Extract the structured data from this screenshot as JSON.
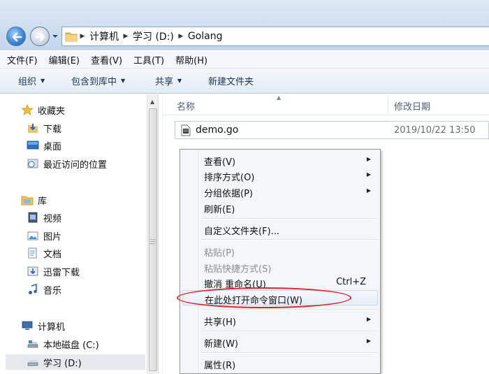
{
  "address_bar": {
    "crumbs": [
      "计算机",
      "学习 (D:)",
      "Golang"
    ]
  },
  "menu_bar": {
    "items": [
      "文件(F)",
      "编辑(E)",
      "查看(V)",
      "工具(T)",
      "帮助(H)"
    ]
  },
  "toolbar": {
    "organize": "组织",
    "include_in_library": "包含到库中",
    "share": "共享",
    "new_folder": "新建文件夹"
  },
  "nav_pane": {
    "favorites": "收藏夹",
    "favorites_items": [
      "下载",
      "桌面",
      "最近访问的位置"
    ],
    "libraries": "库",
    "library_items": [
      "视频",
      "图片",
      "文档",
      "迅雷下载",
      "音乐"
    ],
    "computer": "计算机",
    "computer_items": [
      "本地磁盘 (C:)",
      "学习 (D:)"
    ],
    "selected": "学习 (D:)"
  },
  "file_list": {
    "columns": {
      "name": "名称",
      "modified": "修改日期"
    },
    "files": [
      {
        "name": "demo.go",
        "modified": "2019/10/22 13:50"
      }
    ]
  },
  "context_menu": {
    "items": [
      {
        "label": "查看(V)",
        "submenu": true
      },
      {
        "label": "排序方式(O)",
        "submenu": true
      },
      {
        "label": "分组依据(P)",
        "submenu": true
      },
      {
        "label": "刷新(E)"
      },
      {
        "label": "自定义文件夹(F)..."
      },
      {
        "label": "粘贴(P)",
        "disabled": true
      },
      {
        "label": "粘贴快捷方式(S)",
        "disabled": true
      },
      {
        "label": "撤消 重命名(U)",
        "shortcut": "Ctrl+Z"
      },
      {
        "label": "在此处打开命令窗口(W)",
        "highlighted": true
      },
      {
        "label": "共享(H)",
        "submenu": true
      },
      {
        "label": "新建(W)",
        "submenu": true
      },
      {
        "label": "属性(R)"
      }
    ]
  },
  "colors": {
    "annotation_red": "#e0232b",
    "toolbar_text": "#1c3553",
    "header_text": "#4c607a"
  },
  "icons": {
    "back": "back-arrow-icon",
    "forward": "forward-arrow-icon",
    "folder": "folder-icon",
    "favorites": "star-icon",
    "file": "go-file-icon"
  }
}
